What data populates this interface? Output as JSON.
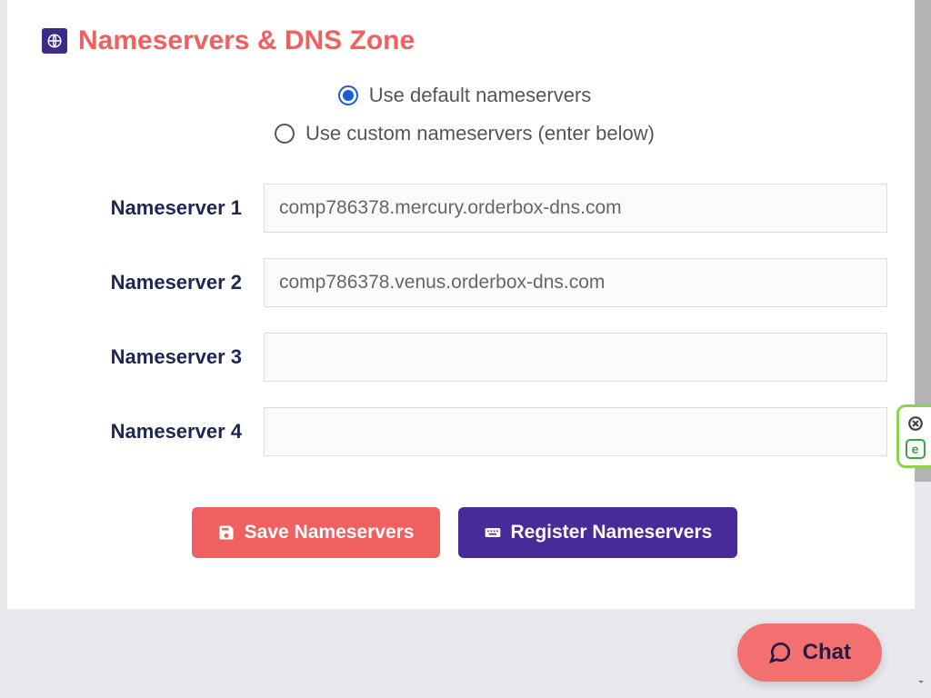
{
  "section": {
    "title": "Nameservers & DNS Zone"
  },
  "radio": {
    "default": {
      "label": "Use default nameservers",
      "selected": true
    },
    "custom": {
      "label": "Use custom nameservers (enter below)",
      "selected": false
    }
  },
  "fields": {
    "ns1": {
      "label": "Nameserver 1",
      "value": "comp786378.mercury.orderbox-dns.com"
    },
    "ns2": {
      "label": "Nameserver 2",
      "value": "comp786378.venus.orderbox-dns.com"
    },
    "ns3": {
      "label": "Nameserver 3",
      "value": ""
    },
    "ns4": {
      "label": "Nameserver 4",
      "value": ""
    }
  },
  "buttons": {
    "save": "Save Nameservers",
    "register": "Register Nameservers"
  },
  "chat": {
    "label": "Chat"
  },
  "widget": {
    "badge": "e"
  }
}
